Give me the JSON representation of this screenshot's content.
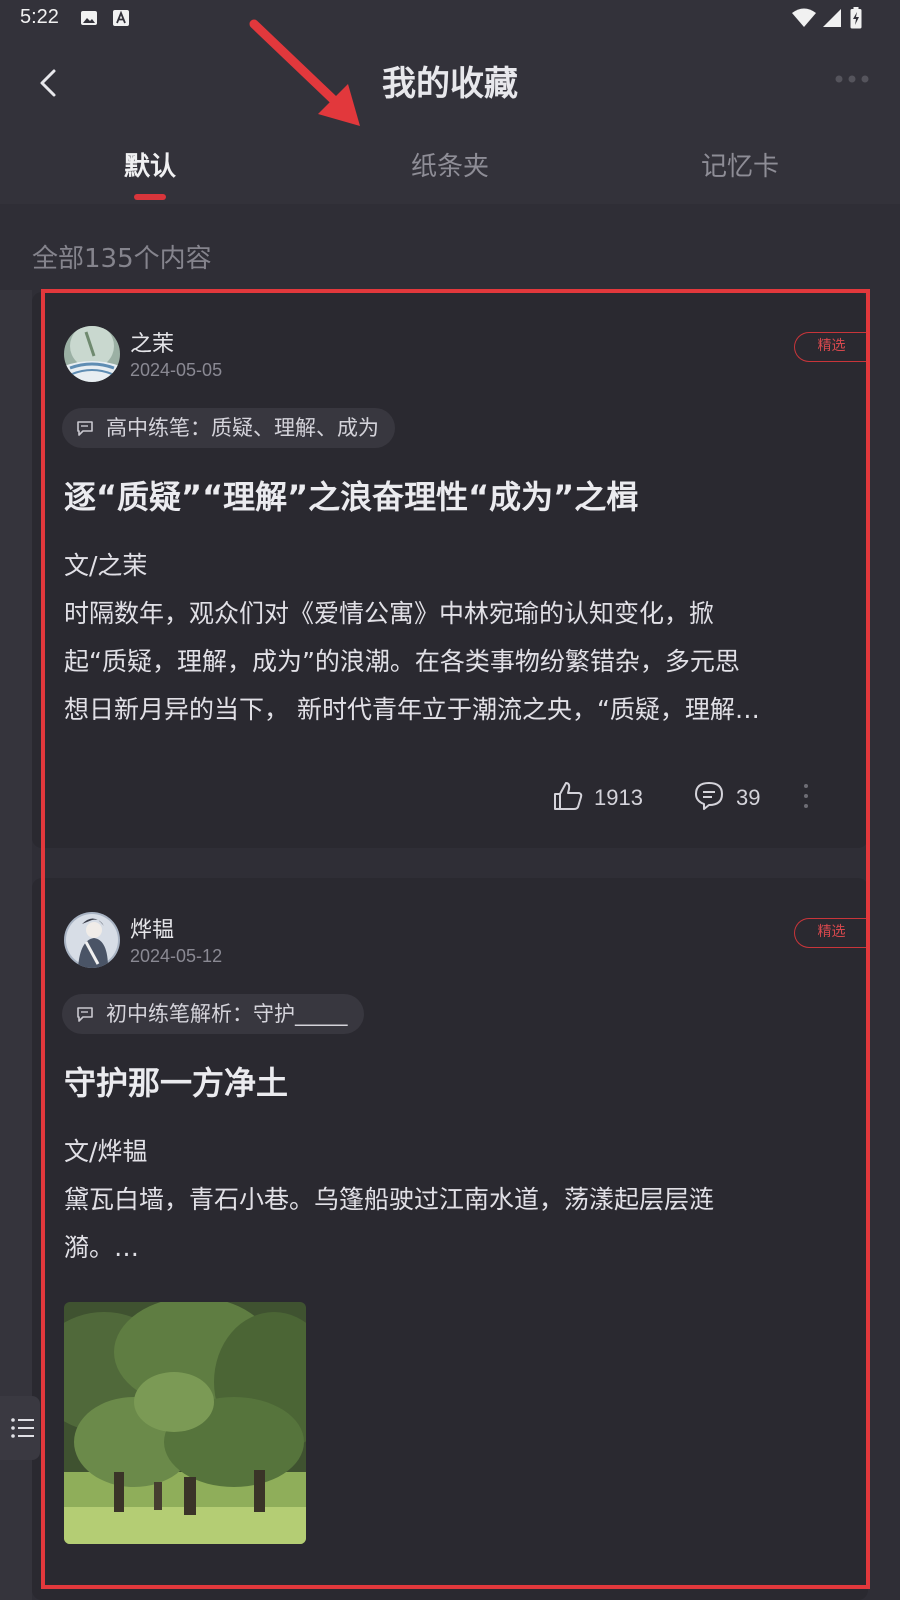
{
  "status_bar": {
    "time": "5:22",
    "icons": [
      "image-icon",
      "a-icon",
      "wifi-icon",
      "signal-icon",
      "battery-charging-icon"
    ]
  },
  "header": {
    "title": "我的收藏",
    "back_icon": "chevron-left-icon",
    "more_icon": "more-dots-icon"
  },
  "tabs": [
    {
      "label": "默认",
      "active": true
    },
    {
      "label": "纸条夹",
      "active": false
    },
    {
      "label": "记忆卡",
      "active": false
    }
  ],
  "summary": {
    "count_text": "全部135个内容"
  },
  "cards": [
    {
      "author": "之茉",
      "date": "2024-05-05",
      "badge": "精选",
      "topic": "高中练笔：质疑、理解、成为",
      "title": "逐“质疑”“理解”之浪奋理性“成为”之楫",
      "byline": "文/之茉",
      "excerpt_lines": [
        "时隔数年，观众们对《爱情公寓》中林宛瑜的认知变化，掀",
        "起“质疑，理解，成为”的浪潮。在各类事物纷繁错杂，多元思",
        "想日新月异的当下， 新时代青年立于潮流之央，“质疑，理解…"
      ],
      "likes": "1913",
      "comments": "39"
    },
    {
      "author": "烨韫",
      "date": "2024-05-12",
      "badge": "精选",
      "topic": "初中练笔解析：守护_____",
      "title": "守护那一方净土",
      "byline": "文/烨韫",
      "excerpt_lines": [
        "黛瓦白墙，青石小巷。乌篷船驶过江南水道，荡漾起层层涟",
        "漪。…"
      ]
    }
  ],
  "colors": {
    "accent": "#d8353b",
    "background": "#2f2e36",
    "card": "#2a2930",
    "header": "#33323a"
  }
}
